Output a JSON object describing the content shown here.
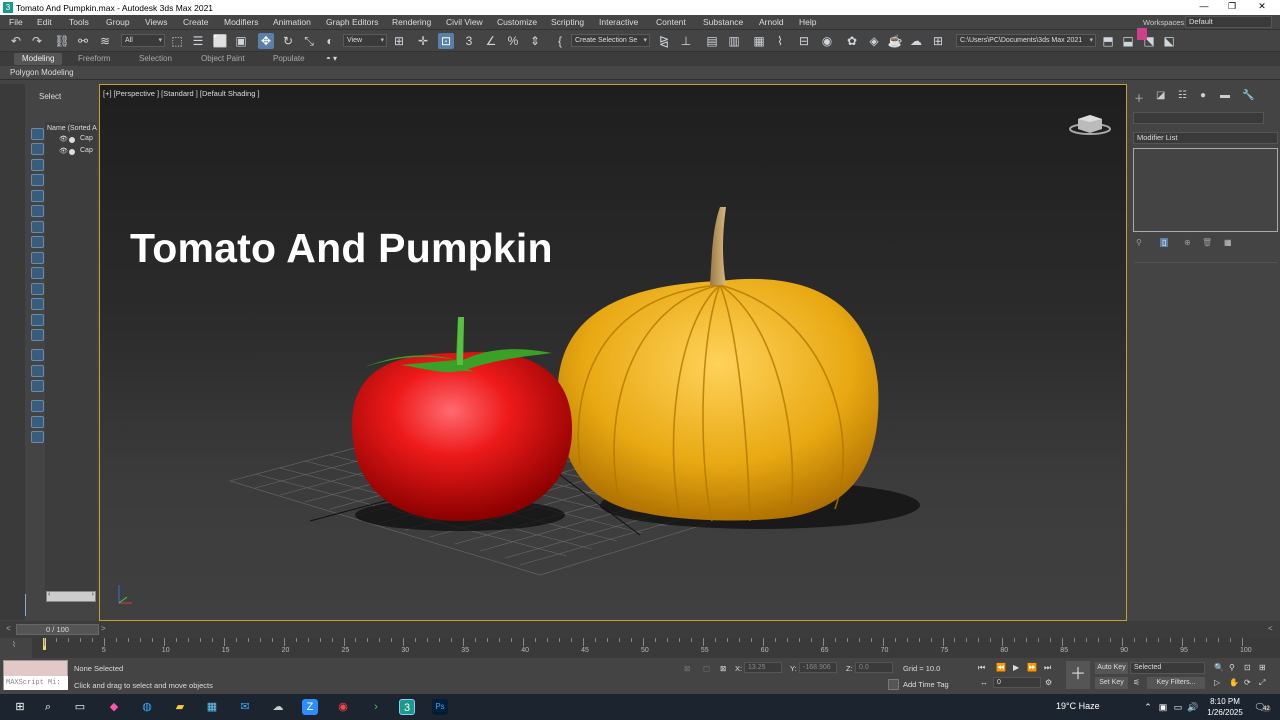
{
  "window": {
    "title": "Tomato And Pumpkin.max - Autodesk 3ds Max 2021",
    "min": "—",
    "restore": "❐",
    "close": "✕"
  },
  "menu": [
    "File",
    "Edit",
    "Tools",
    "Group",
    "Views",
    "Create",
    "Modifiers",
    "Animation",
    "Graph Editors",
    "Rendering",
    "Civil View",
    "Customize",
    "Scripting",
    "Interactive",
    "Content",
    "Substance",
    "Arnold",
    "Help"
  ],
  "workspace": {
    "label": "Workspaces:",
    "value": "Default"
  },
  "toolbar": {
    "filter": "All",
    "view": "View",
    "selection_set": "Create Selection Se",
    "path": "C:\\Users\\PC\\Documents\\3ds Max 2021"
  },
  "ribbon": {
    "tabs": [
      "Modeling",
      "Freeform",
      "Selection",
      "Object Paint",
      "Populate"
    ],
    "sub": "Polygon Modeling"
  },
  "scene_explorer": {
    "title": "Select",
    "header": "Name (Sorted A",
    "items": [
      "Cap",
      "Cap"
    ]
  },
  "viewport": {
    "label": "[+] [Perspective ] [Standard ] [Default Shading ]",
    "scene_title": "Tomato And Pumpkin",
    "viewcube_label": "TOP"
  },
  "command_panel": {
    "modifier_list": "Modifier List",
    "swatch_color": "#d0408a"
  },
  "time": {
    "slider": "0 / 100",
    "ticks": [
      "5",
      "10",
      "15",
      "20",
      "25",
      "30",
      "35",
      "40",
      "45",
      "50",
      "55",
      "60",
      "65",
      "70",
      "75",
      "80",
      "85",
      "90",
      "95",
      "100"
    ]
  },
  "status": {
    "maxscript": "MAXScript Mi:",
    "line1": "None Selected",
    "line2": "Click and drag to select and move objects",
    "x_label": "X:",
    "x_val": "13.25",
    "y_label": "Y:",
    "y_val": "-168.906",
    "z_label": "Z:",
    "z_val": "0.0",
    "grid": "Grid = 10.0",
    "add_time_tag": "Add Time Tag",
    "auto_key": "Auto Key",
    "set_key": "Set Key",
    "selected": "Selected",
    "key_filters": "Key Filters...",
    "frame": "0"
  },
  "taskbar": {
    "weather": "19°C  Haze",
    "time": "8:10 PM",
    "date": "1/26/2025",
    "notifications": "42"
  }
}
